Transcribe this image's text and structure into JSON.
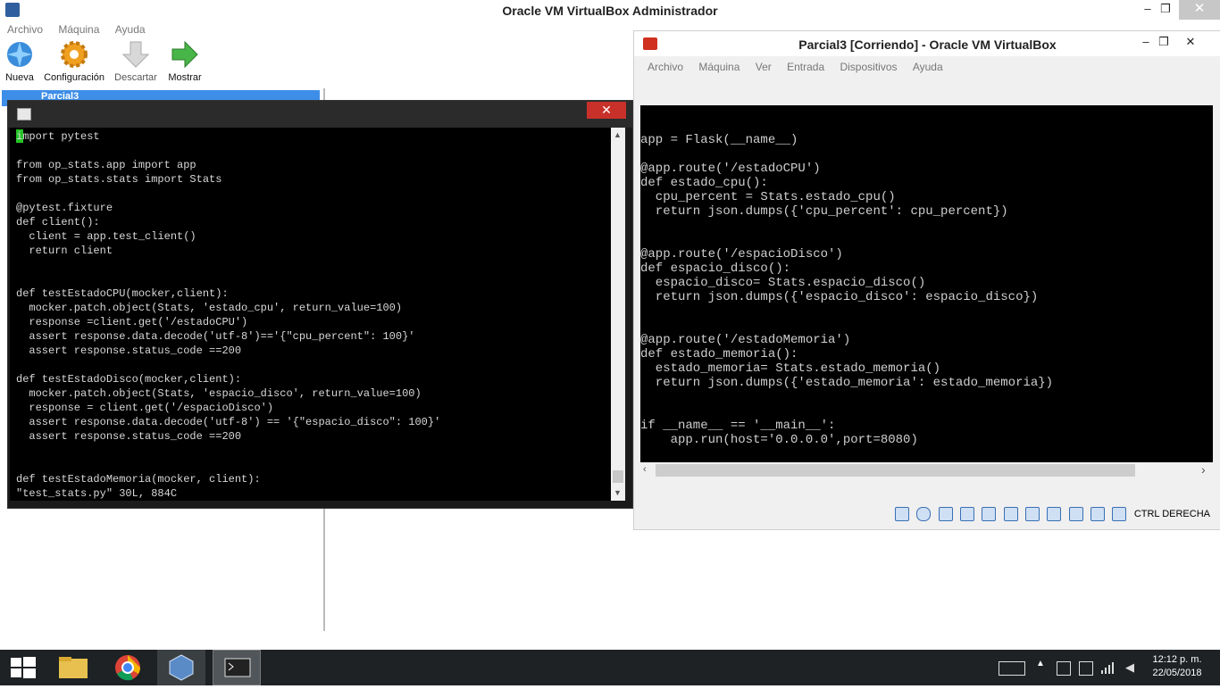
{
  "manager": {
    "title": "Oracle VM VirtualBox Administrador",
    "menu": [
      "Archivo",
      "Máquina",
      "Ayuda"
    ],
    "toolbar": {
      "new_label": "Nueva",
      "settings_label": "Configuración",
      "discard_label": "Descartar",
      "show_label": "Mostrar"
    },
    "selected_vm": "Parcial3",
    "window_controls": {
      "minimize": "–",
      "maximize": "❐",
      "close": "✕"
    }
  },
  "terminal": {
    "close_glyph": "✕",
    "code": "import pytest\n\nfrom op_stats.app import app\nfrom op_stats.stats import Stats\n\n@pytest.fixture\ndef client():\n  client = app.test_client()\n  return client\n\n\ndef testEstadoCPU(mocker,client):\n  mocker.patch.object(Stats, 'estado_cpu', return_value=100)\n  response =client.get('/estadoCPU')\n  assert response.data.decode('utf-8')=='{\"cpu_percent\": 100}'\n  assert response.status_code ==200\n\ndef testEstadoDisco(mocker,client):\n  mocker.patch.object(Stats, 'espacio_disco', return_value=100)\n  response = client.get('/espacioDisco')\n  assert response.data.decode('utf-8') == '{\"espacio_disco\": 100}'\n  assert response.status_code ==200\n\n\ndef testEstadoMemoria(mocker, client):",
    "status_line": "\"test_stats.py\" 30L, 884C"
  },
  "vm_window": {
    "title": "Parcial3 [Corriendo] - Oracle VM VirtualBox",
    "menu": [
      "Archivo",
      "Máquina",
      "Ver",
      "Entrada",
      "Dispositivos",
      "Ayuda"
    ],
    "screen_code": "\napp = Flask(__name__)\n\n@app.route('/estadoCPU')\ndef estado_cpu():\n  cpu_percent = Stats.estado_cpu()\n  return json.dumps({'cpu_percent': cpu_percent})\n\n\n@app.route('/espacioDisco')\ndef espacio_disco():\n  espacio_disco= Stats.espacio_disco()\n  return json.dumps({'espacio_disco': espacio_disco})\n\n\n@app.route('/estadoMemoria')\ndef estado_memoria():\n  estado_memoria= Stats.estado_memoria()\n  return json.dumps({'estado_memoria': estado_memoria})\n\n\nif __name__ == '__main__':\n    app.run(host='0.0.0.0',port=8080)",
    "host_key": "CTRL DERECHA",
    "window_controls": {
      "minimize": "–",
      "maximize": "❐",
      "close": "✕"
    }
  },
  "taskbar": {
    "time": "12:12 p. m.",
    "date": "22/05/2018",
    "apps": [
      "start-icon",
      "file-explorer-icon",
      "chrome-icon",
      "virtualbox-icon",
      "terminal-icon"
    ]
  },
  "colors": {
    "selection": "#3d8ee8",
    "terminal_close": "#c8312a",
    "taskbar": "#1e2224"
  }
}
